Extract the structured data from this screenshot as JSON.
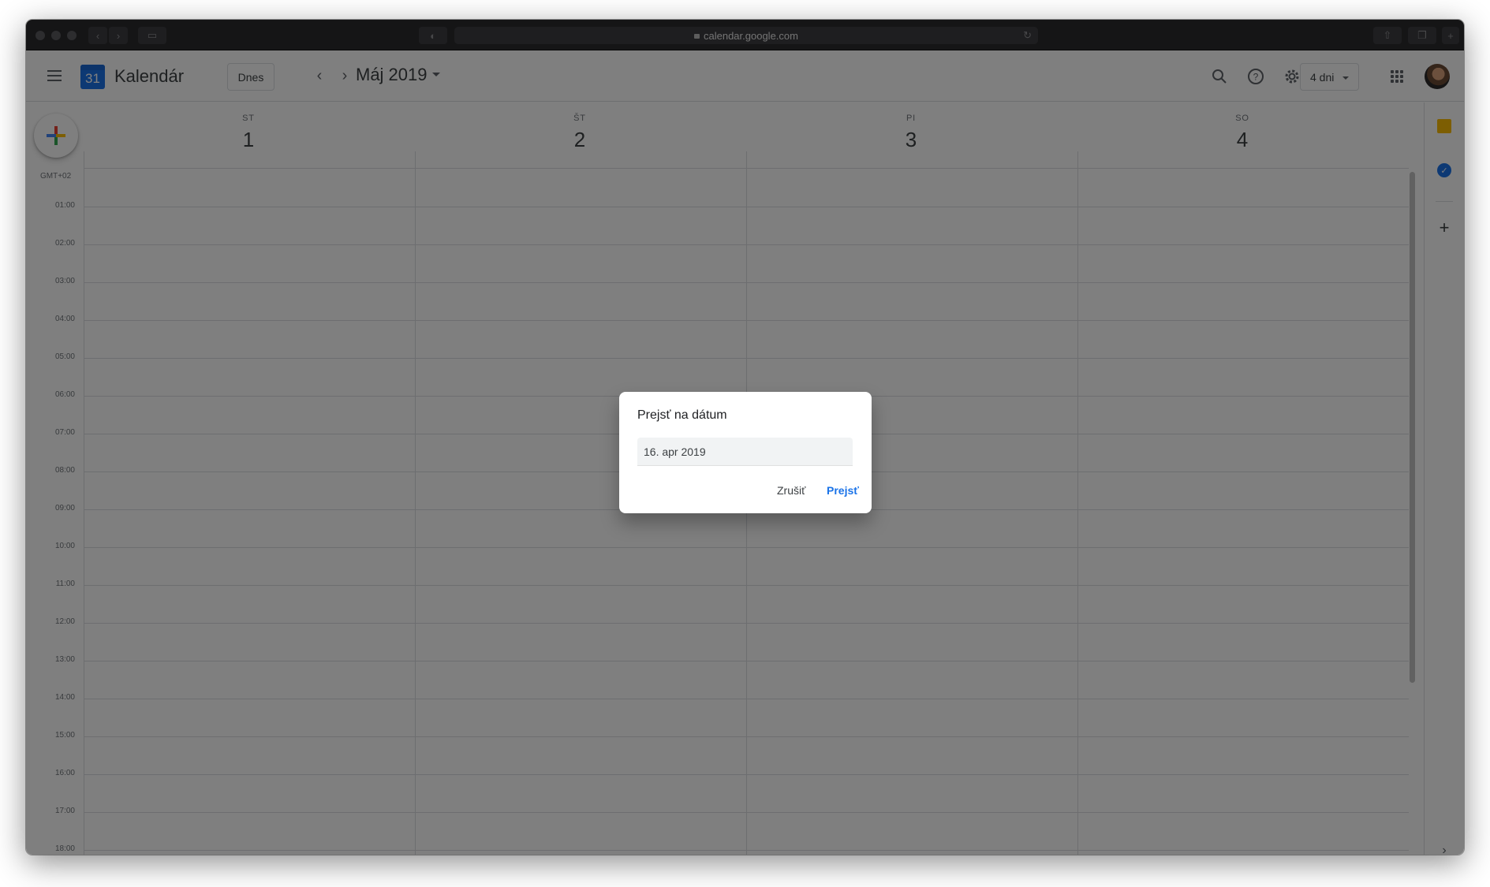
{
  "browser": {
    "url": "calendar.google.com"
  },
  "app": {
    "name": "Kalendár",
    "logo_day": "31",
    "today_label": "Dnes",
    "current_month": "Máj 2019",
    "view_label": "4 dni",
    "timezone": "GMT+02"
  },
  "days": [
    {
      "name": "ST",
      "number": "1"
    },
    {
      "name": "ŠT",
      "number": "2"
    },
    {
      "name": "PI",
      "number": "3"
    },
    {
      "name": "SO",
      "number": "4"
    }
  ],
  "hours": [
    "01:00",
    "02:00",
    "03:00",
    "04:00",
    "05:00",
    "06:00",
    "07:00",
    "08:00",
    "09:00",
    "10:00",
    "11:00",
    "12:00",
    "13:00",
    "14:00",
    "15:00",
    "16:00",
    "17:00",
    "18:00"
  ],
  "dialog": {
    "title": "Prejsť na dátum",
    "date_value": "16. apr 2019",
    "cancel_label": "Zrušiť",
    "go_label": "Prejsť"
  },
  "colors": {
    "accent": "#1a73e8",
    "scrim": "rgba(0,0,0,0.5)",
    "grid_line": "#dadce0"
  }
}
